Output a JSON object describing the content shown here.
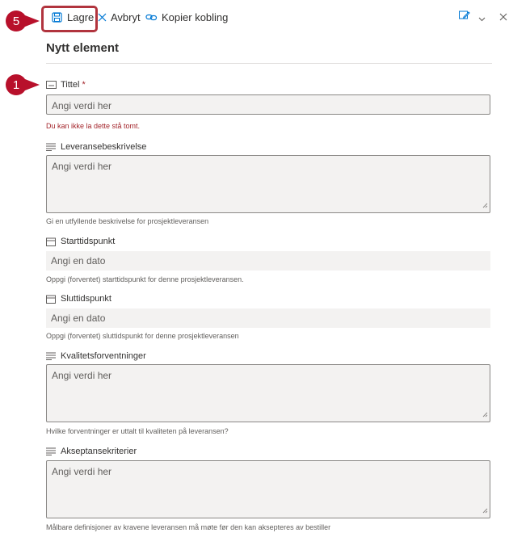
{
  "toolbar": {
    "save_label": "Lagre",
    "cancel_label": "Avbryt",
    "copy_link_label": "Kopier kobling"
  },
  "callouts": {
    "save_step": "5",
    "title_step": "1"
  },
  "form": {
    "heading": "Nytt element",
    "fields": [
      {
        "label": "Tittel",
        "required_marker": "*",
        "placeholder": "Angi verdi her",
        "error": "Du kan ikke la dette stå tomt."
      },
      {
        "label": "Leveransebeskrivelse",
        "placeholder": "Angi verdi her",
        "help": "Gi en utfyllende beskrivelse for prosjektleveransen"
      },
      {
        "label": "Starttidspunkt",
        "placeholder": "Angi en dato",
        "help": "Oppgi (forventet) starttidspunkt for denne prosjektleveransen."
      },
      {
        "label": "Sluttidspunkt",
        "placeholder": "Angi en dato",
        "help": "Oppgi (forventet) sluttidspunkt for denne prosjektleveransen"
      },
      {
        "label": "Kvalitetsforventninger",
        "placeholder": "Angi verdi her",
        "help": "Hvilke forventninger er uttalt til kvaliteten på leveransen?"
      },
      {
        "label": "Akseptansekriterier",
        "placeholder": "Angi verdi her",
        "help": "Målbare definisjoner av kravene leveransen må møte før den kan aksepteres av bestiller"
      }
    ]
  },
  "colors": {
    "callout": "#b8102b",
    "highlight_border": "#b1343e",
    "accent": "#0078d4",
    "error": "#a4262c"
  },
  "icons": [
    "save-icon",
    "cancel-icon",
    "link-icon",
    "form-edit-icon",
    "chevron-down-icon",
    "close-icon",
    "single-line-text-icon",
    "multi-line-text-icon",
    "calendar-icon"
  ]
}
